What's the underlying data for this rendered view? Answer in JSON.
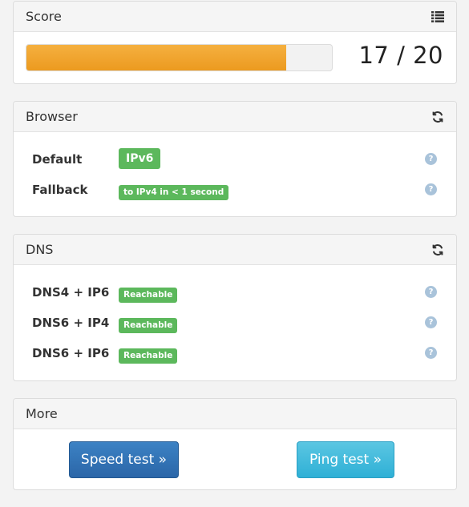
{
  "score": {
    "title": "Score",
    "value_text": "17 / 20",
    "points": 17,
    "max_points": 20,
    "progress_color": "#ec9a1f",
    "header_icon": "list-icon"
  },
  "browser": {
    "title": "Browser",
    "header_icon": "refresh-icon",
    "rows": [
      {
        "label": "Default",
        "badge": "IPv6"
      },
      {
        "label": "Fallback",
        "badge": "to IPv4 in < 1 second"
      }
    ]
  },
  "dns": {
    "title": "DNS",
    "header_icon": "refresh-icon",
    "rows": [
      {
        "label": "DNS4 + IP6",
        "badge": "Reachable"
      },
      {
        "label": "DNS6 + IP4",
        "badge": "Reachable"
      },
      {
        "label": "DNS6 + IP6",
        "badge": "Reachable"
      }
    ]
  },
  "more": {
    "title": "More",
    "speed_button": "Speed test »",
    "ping_button": "Ping test »"
  },
  "colors": {
    "badge_green": "#5cb85c",
    "primary_blue": "#2b66a8",
    "info_cyan": "#2fb0d6",
    "help_icon": "#a9c3da"
  }
}
